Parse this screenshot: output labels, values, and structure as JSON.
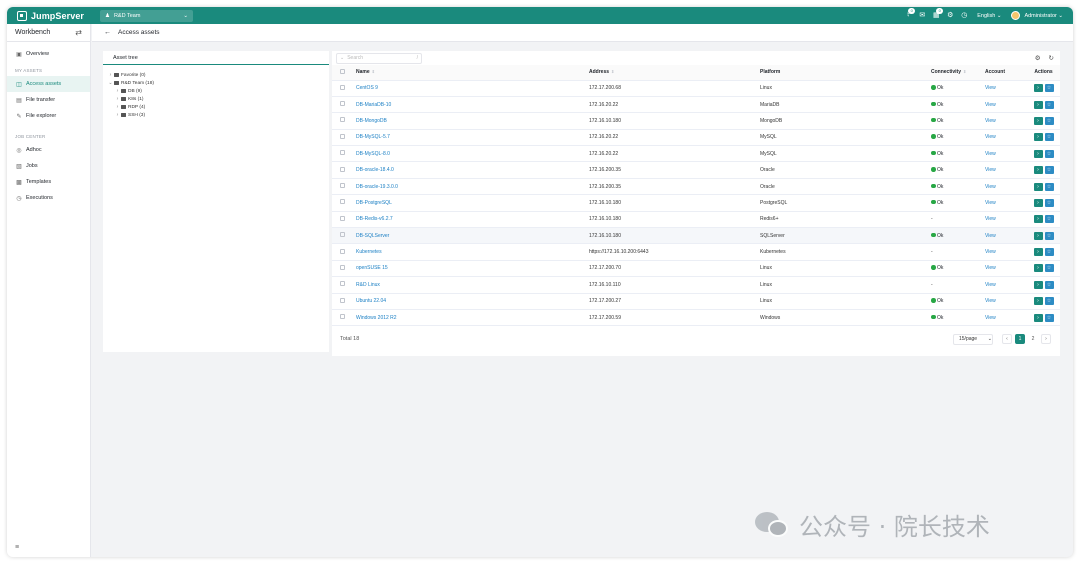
{
  "topbar": {
    "brand": "JumpServer",
    "org": "R&D Team",
    "badge1": "0",
    "badge2": "0",
    "language": "English",
    "user": "Administrator"
  },
  "sidebar": {
    "title": "Workbench",
    "overview": "Overview",
    "section_assets": "MY ASSETS",
    "items_assets": [
      "Access assets",
      "File transfer",
      "File explorer"
    ],
    "section_jobs": "JOB CENTER",
    "items_jobs": [
      "Adhoc",
      "Jobs",
      "Templates",
      "Executions"
    ]
  },
  "breadcrumb": {
    "title": "Access assets"
  },
  "tree": {
    "header": "Asset tree",
    "nodes": [
      {
        "label": "Favorite (0)",
        "level": 0
      },
      {
        "label": "R&D Team (18)",
        "level": 0
      },
      {
        "label": "DB (9)",
        "level": 1
      },
      {
        "label": "K8s (1)",
        "level": 1
      },
      {
        "label": "RDP (4)",
        "level": 1
      },
      {
        "label": "SSH (3)",
        "level": 1
      }
    ]
  },
  "search": {
    "placeholder": "Search",
    "shortcut": "/"
  },
  "table": {
    "headers": {
      "name": "Name",
      "address": "Address",
      "platform": "Platform",
      "connectivity": "Connectivity",
      "account": "Account",
      "actions": "Actions"
    },
    "rows": [
      {
        "name": "CentOS 9",
        "address": "172.17.200.68",
        "platform": "Linux",
        "connectivity": "Ok",
        "account": "View"
      },
      {
        "name": "DB-MariaDB-10",
        "address": "172.16.20.22",
        "platform": "MariaDB",
        "connectivity": "Ok",
        "account": "View"
      },
      {
        "name": "DB-MongoDB",
        "address": "172.16.10.180",
        "platform": "MongoDB",
        "connectivity": "Ok",
        "account": "View"
      },
      {
        "name": "DB-MySQL-5.7",
        "address": "172.16.20.22",
        "platform": "MySQL",
        "connectivity": "Ok",
        "account": "View"
      },
      {
        "name": "DB-MySQL-8.0",
        "address": "172.16.20.22",
        "platform": "MySQL",
        "connectivity": "Ok",
        "account": "View"
      },
      {
        "name": "DB-oracle-18.4.0",
        "address": "172.16.200.35",
        "platform": "Oracle",
        "connectivity": "Ok",
        "account": "View"
      },
      {
        "name": "DB-oracle-19.3.0.0",
        "address": "172.16.200.35",
        "platform": "Oracle",
        "connectivity": "Ok",
        "account": "View"
      },
      {
        "name": "DB-PostgreSQL",
        "address": "172.16.10.180",
        "platform": "PostgreSQL",
        "connectivity": "Ok",
        "account": "View"
      },
      {
        "name": "DB-Redis-v6.2.7",
        "address": "172.16.10.180",
        "platform": "Redis6+",
        "connectivity": "-",
        "account": "View"
      },
      {
        "name": "DB-SQLServer",
        "address": "172.16.10.180",
        "platform": "SQLServer",
        "connectivity": "Ok",
        "account": "View"
      },
      {
        "name": "Kubernetes",
        "address": "https://172.16.10.200:6443",
        "platform": "Kubernetes",
        "connectivity": "-",
        "account": "View"
      },
      {
        "name": "openSUSE 15",
        "address": "172.17.200.70",
        "platform": "Linux",
        "connectivity": "Ok",
        "account": "View"
      },
      {
        "name": "R&D Linux",
        "address": "172.16.10.110",
        "platform": "Linux",
        "connectivity": "-",
        "account": "View"
      },
      {
        "name": "Ubuntu 22.04",
        "address": "172.17.200.27",
        "platform": "Linux",
        "connectivity": "Ok",
        "account": "View"
      },
      {
        "name": "Windows 2012 R2",
        "address": "172.17.200.59",
        "platform": "Windows",
        "connectivity": "Ok",
        "account": "View"
      }
    ],
    "highlight_row": 9
  },
  "footer": {
    "total": "Total 18",
    "page_size": "15/page",
    "pages": [
      "1",
      "2"
    ],
    "current_page": "1"
  },
  "watermark": {
    "text": "公众号 · 院长技术"
  },
  "colors": {
    "brand": "#1a8a7d",
    "link": "#1a7fc4",
    "ok": "#28a745"
  },
  "icons": {
    "topbar": [
      "bell-icon",
      "message-icon",
      "calendar-icon",
      "settings-icon",
      "help-icon"
    ],
    "sidebar": [
      "overview-icon",
      "access-assets-icon",
      "file-transfer-icon",
      "file-explorer-icon",
      "adhoc-icon",
      "jobs-icon",
      "templates-icon",
      "executions-icon"
    ]
  }
}
